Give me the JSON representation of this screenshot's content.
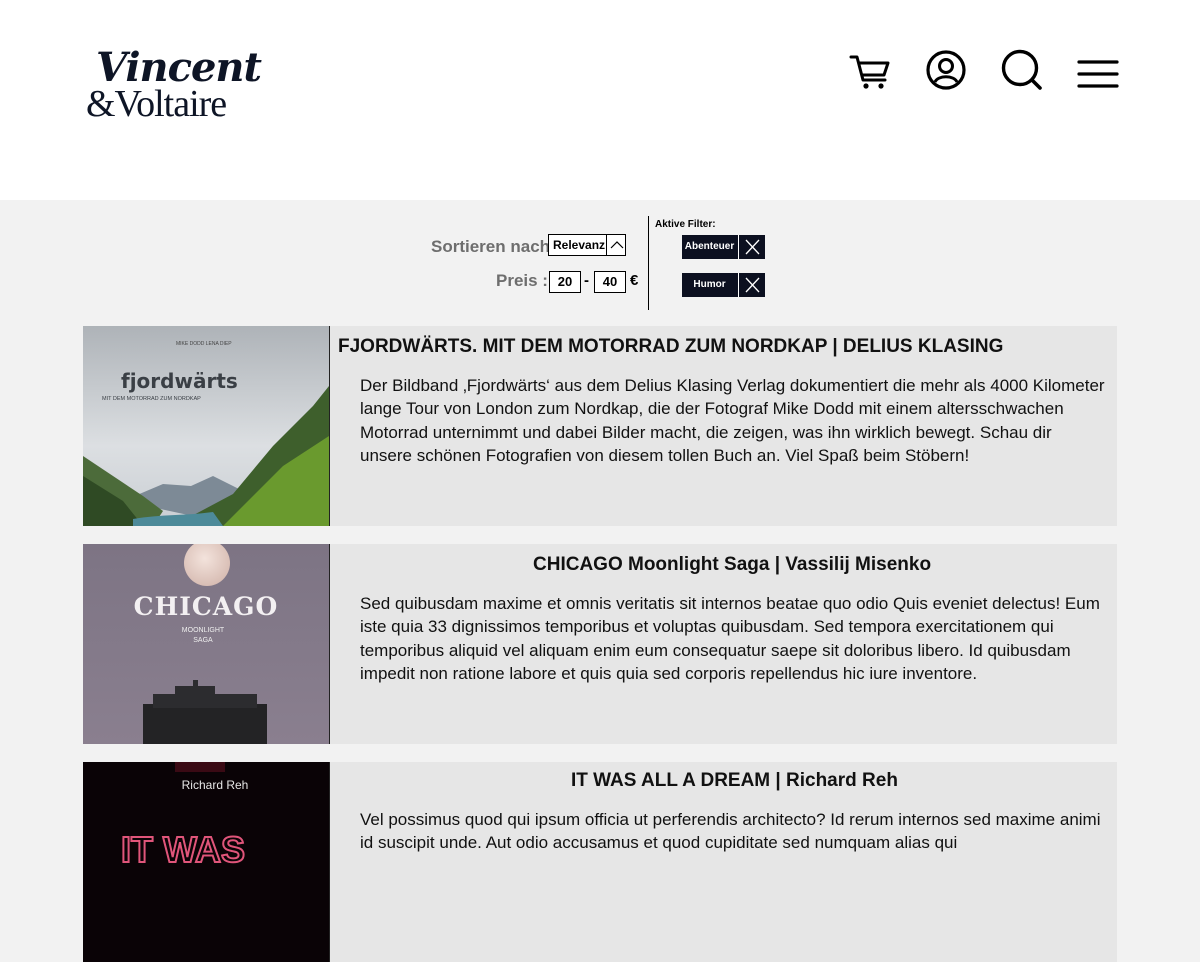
{
  "header": {
    "logo_line1": "Vincent",
    "logo_line2": "&Voltaire",
    "icons": [
      "cart-icon",
      "user-icon",
      "search-icon",
      "menu-icon"
    ]
  },
  "filters": {
    "sort_label": "Sortieren nach:",
    "sort_value": "Relevanz",
    "price_label": "Preis :",
    "price_min": "20",
    "price_dash": "-",
    "price_max": "40",
    "currency": "€",
    "active_label": "Aktive Filter:",
    "active": [
      "Abenteuer",
      "Humor"
    ]
  },
  "books": [
    {
      "title": "FJORDWÄRTS. MIT DEM MOTORRAD ZUM NORDKAP | DELIUS KLASING",
      "description": "Der Bildband ‚Fjordwärts‘ aus dem Delius Klasing Verlag dokumentiert die mehr als 4000 Kilometer lange Tour von London zum Nordkap, die der Fotograf Mike Dodd mit einem altersschwachen Motorrad unternimmt und dabei Bilder macht, die zeigen, was ihn wirklich bewegt. Schau dir unsere schönen Fotografien von diesem tollen Buch an. Viel Spaß beim Stöbern!",
      "cover": {
        "authors": "MIKE DODD     LENA DIEP",
        "title": "fjordwärts",
        "subtitle": "MIT DEM MOTORRAD ZUM NORDKAP"
      }
    },
    {
      "title": "CHICAGO Moonlight Saga |  Vassilij Misenko",
      "description": "Sed quibusdam maxime et omnis veritatis sit internos beatae quo odio Quis eveniet delectus! Eum iste quia 33 dignissimos temporibus et voluptas quibusdam. Sed tempora exercitationem qui temporibus aliquid vel aliquam enim eum consequatur saepe sit doloribus libero. Id quibusdam impedit non ratione labore et quis quia sed corporis repellendus hic iure inventore.",
      "cover": {
        "title": "CHICAGO",
        "line1": "MOONLIGHT",
        "line2": "SAGA"
      }
    },
    {
      "title": "IT WAS ALL A DREAM | Richard Reh",
      "description": "Vel possimus quod qui ipsum officia ut perferendis architecto? Id rerum internos sed maxime animi id suscipit unde. Aut odio accusamus et quod cupiditate sed numquam alias qui",
      "cover": {
        "author": "Richard Reh",
        "neon": "IT WAS"
      }
    }
  ]
}
